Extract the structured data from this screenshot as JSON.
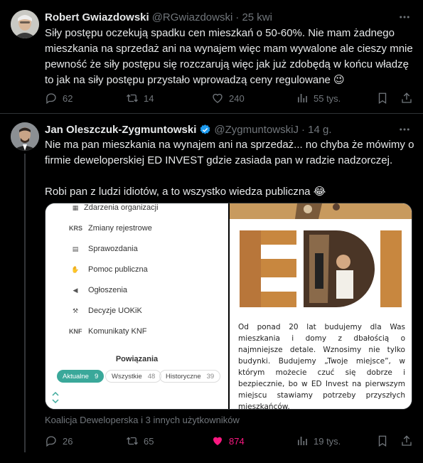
{
  "tweet1": {
    "name": "Robert Gwiazdowski",
    "handle": "@RGwiazdowski",
    "time": "· 25 kwi",
    "text": "Siły postępu oczekują spadku cen mieszkań o 50-60%. Nie mam żadnego mieszkania na sprzedaż ani na wynajem więc mam wywalone ale cieszy mnie pewność że siły postępu się rozczarują więc jak już zdobędą w końcu władzę to jak na siły postępu przystało wprowadzą ceny regulowane 😉",
    "replies": "62",
    "retweets": "14",
    "likes": "240",
    "views": "55 tys."
  },
  "tweet2": {
    "name": "Jan Oleszczuk-Zygmuntowski",
    "handle": "@ZygmuntowskiJ",
    "time": "· 14 g.",
    "text": "Nie ma pan mieszkania na wynajem ani na sprzedaż... no chyba że mówimy o firmie deweloperskiej ED INVEST gdzie zasiada pan w radzie nadzorczej.\n\nRobi pan z ludzi idiotów, a to wszystko wiedza publiczna 😂",
    "caption": "Koalicja Deweloperska i 3 innych użytkowników",
    "replies": "26",
    "retweets": "65",
    "likes": "874",
    "views": "19 tys."
  },
  "media": {
    "left": {
      "header": "Zdarzenia organizacji",
      "items": [
        {
          "icon": "KRS",
          "label": "Zmiany rejestrowe"
        },
        {
          "icon": "doc",
          "label": "Sprawozdania"
        },
        {
          "icon": "hands",
          "label": "Pomoc publiczna"
        },
        {
          "icon": "megaphone",
          "label": "Ogłoszenia"
        },
        {
          "icon": "gavel",
          "label": "Decyzje UOKiK"
        },
        {
          "icon": "KNF",
          "label": "Komunikaty KNF"
        }
      ],
      "section": "Powiązania",
      "tabs": [
        {
          "label": "Aktualne",
          "count": "9"
        },
        {
          "label": "Wszystkie",
          "count": "48"
        },
        {
          "label": "Historyczne",
          "count": "39"
        }
      ]
    },
    "right": {
      "logo": "ED",
      "text": "Od ponad 20 lat budujemy dla Was mieszkania i domy z dbałością o najmniejsze detale. Wznosimy nie tylko budynki. Budujemy „Twoje miejsce”, w którym możecie czuć się dobrze i bezpiecznie, bo w ED Invest na pierwszym miejscu stawiamy potrzeby przyszłych mieszkańców."
    }
  },
  "colors": {
    "background": "#000000",
    "text": "#e7e9ea",
    "muted": "#71767b",
    "like": "#f91880",
    "verified": "#1d9bf0",
    "tab_active": "#3aa89a"
  }
}
